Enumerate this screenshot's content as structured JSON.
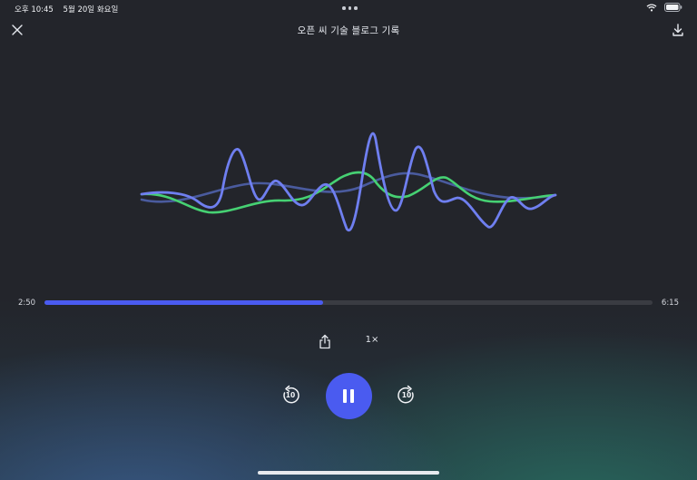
{
  "status_bar": {
    "time": "오후 10:45",
    "date": "5월 20일 화요일"
  },
  "header": {
    "title": "오픈 씨 기술 블로그 기록",
    "close_icon": "close-icon",
    "download_icon": "download-icon"
  },
  "player": {
    "current_time": "2:50",
    "total_time": "6:15",
    "progress": 0.458,
    "speed_label": "1×",
    "skip_back_label": "10",
    "skip_forward_label": "10",
    "state": "playing"
  },
  "colors": {
    "accent": "#4a5bf0",
    "wave_blue": "#6f7ff0",
    "wave_green": "#46d173",
    "wave_faint": "#4a5b9e"
  }
}
